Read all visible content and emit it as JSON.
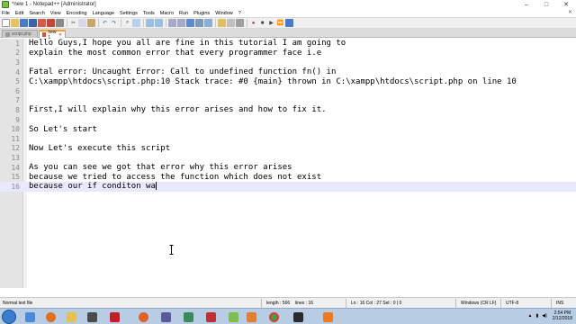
{
  "window": {
    "title": "*new 1 - Notepad++ [Administrator]"
  },
  "menu": [
    "File",
    "Edit",
    "Search",
    "View",
    "Encoding",
    "Language",
    "Settings",
    "Tools",
    "Macro",
    "Run",
    "Plugins",
    "Window",
    "?"
  ],
  "tabs": [
    {
      "label": "script.php",
      "active": false
    },
    {
      "label": "new 1",
      "active": true
    }
  ],
  "editor": {
    "lines": [
      {
        "n": "1",
        "text": "Hello Guys,I hope you all are fine in this tutorial I am going to"
      },
      {
        "n": "2",
        "text": "explain the most common error that every programmer face i.e"
      },
      {
        "n": "3",
        "text": ""
      },
      {
        "n": "4",
        "text": "Fatal error: Uncaught Error: Call to undefined function fn() in"
      },
      {
        "n": "5",
        "text": "C:\\xampp\\htdocs\\script.php:10 Stack trace: #0 {main} thrown in C:\\xampp\\htdocs\\script.php on line 10"
      },
      {
        "n": "6",
        "text": ""
      },
      {
        "n": "7",
        "text": ""
      },
      {
        "n": "8",
        "text": "First,I will explain why this error arises and how to fix it."
      },
      {
        "n": "9",
        "text": ""
      },
      {
        "n": "10",
        "text": "So Let's start"
      },
      {
        "n": "11",
        "text": ""
      },
      {
        "n": "12",
        "text": "Now Let's execute this script"
      },
      {
        "n": "13",
        "text": ""
      },
      {
        "n": "14",
        "text": "As you can see we got that error why this error arises"
      },
      {
        "n": "15",
        "text": "because we tried to access the function which does not exist"
      },
      {
        "n": "16",
        "text": "because our if conditon wa"
      }
    ],
    "current_line": 16
  },
  "status": {
    "file_type": "Normal text file",
    "length": "length : 566",
    "lines": "lines : 16",
    "position": "Ln : 16   Col : 27   Sel : 0 | 0",
    "eol": "Windows (CR LF)",
    "encoding": "UTF-8",
    "mode": "INS"
  },
  "taskbar": {
    "time": "2:54 PM",
    "date": "2/12/2018",
    "apps": [
      "explorer-icon",
      "media-player-icon",
      "explorer-folder-icon",
      "acrobat-icon",
      "firefox-icon",
      "settings-icon",
      "photos-icon",
      "filezilla-icon",
      "notepadpp-icon",
      "sublime-icon",
      "chrome-icon",
      "terminal-icon",
      "xampp-icon"
    ],
    "colors": {
      "bar": "#b8cde4",
      "active_tab_accent": "#f5a623"
    }
  }
}
